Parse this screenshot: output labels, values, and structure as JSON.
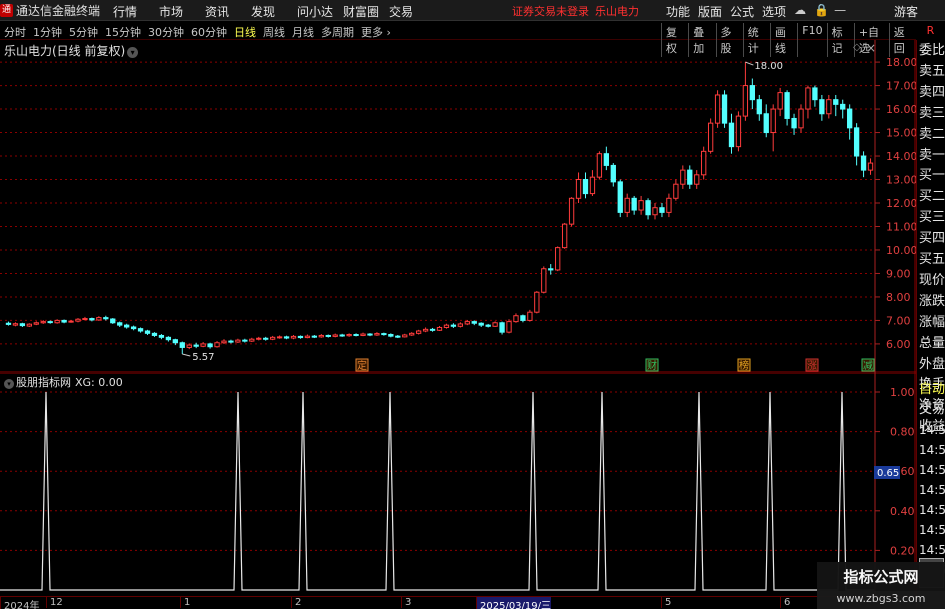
{
  "app": {
    "title": "通达信金融终端",
    "logo_text": "通"
  },
  "menu": [
    "行情",
    "市场",
    "资讯",
    "发现",
    "问小达",
    "财富圈",
    "交易"
  ],
  "notice": {
    "login_msg": "证券交易未登录",
    "stock_name": "乐山电力"
  },
  "top_right": [
    "功能",
    "版面",
    "公式",
    "选项"
  ],
  "user": "游客",
  "period_tabs": [
    {
      "label": "分时",
      "active": false
    },
    {
      "label": "1分钟",
      "active": false
    },
    {
      "label": "5分钟",
      "active": false
    },
    {
      "label": "15分钟",
      "active": false
    },
    {
      "label": "30分钟",
      "active": false
    },
    {
      "label": "60分钟",
      "active": false
    },
    {
      "label": "日线",
      "active": true
    },
    {
      "label": "周线",
      "active": false
    },
    {
      "label": "月线",
      "active": false
    },
    {
      "label": "多周期",
      "active": false
    },
    {
      "label": "更多 ›",
      "active": false
    }
  ],
  "chart_tools": [
    "复权",
    "叠加",
    "多股",
    "统计",
    "画线",
    "F10",
    "标记",
    "+自选",
    "返回"
  ],
  "rpanel_top": "R",
  "stock_label": "乐山电力(日线 前复权)",
  "indicator_label": {
    "name": "股朋指标网",
    "value": "XG: 0.00"
  },
  "side_panel": [
    "委比",
    "卖五",
    "卖四",
    "卖三",
    "卖二",
    "卖一",
    "买一",
    "买二",
    "买三",
    "买四",
    "买五",
    "现价",
    "涨跌",
    "涨幅",
    "总量",
    "外盘",
    "换手",
    "净资",
    "收益"
  ],
  "side_panel_lower": [
    {
      "label": "自动",
      "highlight": true
    },
    {
      "label": "交易",
      "highlight": false
    },
    {
      "label": "14:56",
      "highlight": false
    },
    {
      "label": "14:56",
      "highlight": false
    },
    {
      "label": "14:56",
      "highlight": false
    },
    {
      "label": "14:56",
      "highlight": false
    },
    {
      "label": "14:56",
      "highlight": false
    },
    {
      "label": "14:56",
      "highlight": false
    },
    {
      "label": "14:56",
      "highlight": false
    },
    {
      "label": "14:56",
      "highlight": false
    }
  ],
  "price_axis": [
    "18.00",
    "17.00",
    "16.00",
    "15.00",
    "14.00",
    "13.00",
    "12.00",
    "11.00",
    "10.00",
    "9.00",
    "8.00",
    "7.00",
    "6.00"
  ],
  "ind_axis": [
    "1.00",
    "0.80",
    "0.60",
    "0.40",
    "0.20"
  ],
  "ind_current": "0.65",
  "annotations": {
    "high": "18.00",
    "low": "5.57"
  },
  "event_tags": [
    "定",
    "财",
    "榜",
    "涨",
    "减"
  ],
  "date_labels": [
    {
      "label": "2024年",
      "current": false
    },
    {
      "label": "12",
      "current": false
    },
    {
      "label": "1",
      "current": false
    },
    {
      "label": "2",
      "current": false
    },
    {
      "label": "3",
      "current": false
    },
    {
      "label": "2025/03/19/三",
      "current": true
    },
    {
      "label": "5",
      "current": false
    },
    {
      "label": "6",
      "current": false
    }
  ],
  "watermark": {
    "line1": "指标公式网",
    "line2": "www.zbgs3.com"
  },
  "chart_data": {
    "type": "candlestick",
    "title": "乐山电力(日线 前复权)",
    "ylim": [
      5.4,
      18.6
    ],
    "colors": {
      "up": "#ff3c3c",
      "down": "#54ffff",
      "grid": "#8b0000"
    },
    "candles": [
      [
        6.88,
        6.83,
        6.95,
        6.78
      ],
      [
        6.8,
        6.86,
        6.92,
        6.75
      ],
      [
        6.86,
        6.78,
        6.9,
        6.72
      ],
      [
        6.76,
        6.84,
        6.88,
        6.72
      ],
      [
        6.84,
        6.9,
        6.96,
        6.8
      ],
      [
        6.9,
        6.95,
        7.01,
        6.85
      ],
      [
        6.95,
        6.92,
        7.0,
        6.86
      ],
      [
        6.9,
        7.0,
        7.05,
        6.86
      ],
      [
        7.0,
        6.93,
        7.04,
        6.88
      ],
      [
        6.93,
        6.97,
        7.02,
        6.9
      ],
      [
        6.97,
        7.05,
        7.1,
        6.92
      ],
      [
        7.05,
        7.08,
        7.15,
        7.0
      ],
      [
        7.08,
        7.02,
        7.12,
        6.96
      ],
      [
        7.02,
        7.12,
        7.18,
        6.98
      ],
      [
        7.12,
        7.07,
        7.2,
        7.0
      ],
      [
        7.06,
        6.9,
        7.1,
        6.85
      ],
      [
        6.9,
        6.8,
        6.95,
        6.72
      ],
      [
        6.8,
        6.72,
        6.86,
        6.65
      ],
      [
        6.72,
        6.65,
        6.78,
        6.58
      ],
      [
        6.65,
        6.55,
        6.7,
        6.48
      ],
      [
        6.55,
        6.45,
        6.6,
        6.38
      ],
      [
        6.45,
        6.36,
        6.5,
        6.3
      ],
      [
        6.36,
        6.28,
        6.42,
        6.2
      ],
      [
        6.28,
        6.18,
        6.33,
        6.1
      ],
      [
        6.18,
        6.05,
        6.22,
        5.95
      ],
      [
        6.05,
        5.85,
        6.1,
        5.57
      ],
      [
        5.85,
        5.95,
        6.02,
        5.78
      ],
      [
        5.95,
        5.9,
        6.05,
        5.82
      ],
      [
        5.9,
        6.0,
        6.08,
        5.86
      ],
      [
        6.0,
        5.88,
        6.05,
        5.8
      ],
      [
        5.88,
        6.05,
        6.12,
        5.84
      ],
      [
        6.05,
        6.12,
        6.2,
        6.0
      ],
      [
        6.12,
        6.08,
        6.18,
        6.02
      ],
      [
        6.08,
        6.16,
        6.22,
        6.04
      ],
      [
        6.16,
        6.12,
        6.22,
        6.06
      ],
      [
        6.12,
        6.2,
        6.26,
        6.08
      ],
      [
        6.2,
        6.24,
        6.3,
        6.15
      ],
      [
        6.24,
        6.2,
        6.3,
        6.14
      ],
      [
        6.2,
        6.28,
        6.34,
        6.16
      ],
      [
        6.28,
        6.3,
        6.36,
        6.22
      ],
      [
        6.3,
        6.25,
        6.35,
        6.2
      ],
      [
        6.25,
        6.32,
        6.38,
        6.2
      ],
      [
        6.32,
        6.27,
        6.36,
        6.22
      ],
      [
        6.27,
        6.33,
        6.4,
        6.24
      ],
      [
        6.33,
        6.3,
        6.38,
        6.25
      ],
      [
        6.3,
        6.36,
        6.42,
        6.26
      ],
      [
        6.36,
        6.32,
        6.4,
        6.27
      ],
      [
        6.32,
        6.38,
        6.44,
        6.28
      ],
      [
        6.38,
        6.35,
        6.43,
        6.3
      ],
      [
        6.35,
        6.4,
        6.45,
        6.3
      ],
      [
        6.4,
        6.36,
        6.45,
        6.32
      ],
      [
        6.36,
        6.42,
        6.48,
        6.33
      ],
      [
        6.42,
        6.38,
        6.46,
        6.33
      ],
      [
        6.38,
        6.44,
        6.5,
        6.34
      ],
      [
        6.44,
        6.4,
        6.48,
        6.35
      ],
      [
        6.4,
        6.33,
        6.45,
        6.28
      ],
      [
        6.33,
        6.3,
        6.38,
        6.25
      ],
      [
        6.3,
        6.38,
        6.43,
        6.27
      ],
      [
        6.38,
        6.45,
        6.5,
        6.34
      ],
      [
        6.45,
        6.55,
        6.6,
        6.4
      ],
      [
        6.55,
        6.62,
        6.7,
        6.5
      ],
      [
        6.62,
        6.58,
        6.68,
        6.52
      ],
      [
        6.58,
        6.7,
        6.76,
        6.55
      ],
      [
        6.7,
        6.8,
        6.86,
        6.65
      ],
      [
        6.8,
        6.75,
        6.88,
        6.68
      ],
      [
        6.75,
        6.85,
        6.92,
        6.7
      ],
      [
        6.85,
        6.95,
        7.02,
        6.8
      ],
      [
        6.95,
        6.88,
        7.0,
        6.8
      ],
      [
        6.88,
        6.8,
        6.92,
        6.72
      ],
      [
        6.8,
        6.75,
        6.85,
        6.7
      ],
      [
        6.75,
        6.9,
        6.96,
        6.72
      ],
      [
        6.9,
        6.5,
        6.95,
        6.4
      ],
      [
        6.5,
        6.95,
        7.05,
        6.45
      ],
      [
        6.95,
        7.2,
        7.3,
        6.9
      ],
      [
        7.2,
        7.0,
        7.25,
        6.92
      ],
      [
        7.0,
        7.35,
        7.45,
        6.95
      ],
      [
        7.35,
        8.2,
        8.25,
        7.3
      ],
      [
        8.2,
        9.2,
        9.3,
        8.15
      ],
      [
        9.2,
        9.15,
        9.4,
        8.95
      ],
      [
        9.15,
        10.1,
        10.15,
        9.1
      ],
      [
        10.1,
        11.1,
        11.15,
        10.05
      ],
      [
        11.1,
        12.2,
        12.25,
        11.0
      ],
      [
        12.2,
        13.0,
        13.3,
        12.0
      ],
      [
        13.0,
        12.4,
        13.3,
        12.2
      ],
      [
        12.4,
        13.1,
        13.4,
        12.3
      ],
      [
        13.1,
        14.1,
        14.2,
        13.0
      ],
      [
        14.1,
        13.6,
        14.4,
        13.4
      ],
      [
        13.6,
        12.9,
        13.7,
        12.7
      ],
      [
        12.9,
        11.6,
        13.0,
        11.4
      ],
      [
        11.6,
        12.2,
        12.4,
        11.4
      ],
      [
        12.2,
        11.7,
        12.3,
        11.5
      ],
      [
        11.7,
        12.1,
        12.3,
        11.5
      ],
      [
        12.1,
        11.5,
        12.2,
        11.3
      ],
      [
        11.5,
        11.8,
        12.0,
        11.3
      ],
      [
        11.8,
        11.6,
        12.0,
        11.4
      ],
      [
        11.6,
        12.2,
        12.4,
        11.4
      ],
      [
        12.2,
        12.8,
        13.0,
        12.1
      ],
      [
        12.8,
        13.4,
        13.6,
        12.6
      ],
      [
        13.4,
        12.8,
        13.6,
        12.6
      ],
      [
        12.8,
        13.2,
        13.4,
        12.6
      ],
      [
        13.2,
        14.2,
        14.4,
        13.0
      ],
      [
        14.2,
        15.4,
        15.6,
        14.1
      ],
      [
        15.4,
        16.6,
        16.8,
        15.2
      ],
      [
        16.6,
        15.4,
        16.8,
        15.2
      ],
      [
        15.4,
        14.4,
        15.8,
        14.1
      ],
      [
        14.4,
        15.7,
        15.9,
        14.2
      ],
      [
        15.7,
        17.0,
        18.0,
        15.5
      ],
      [
        17.0,
        16.4,
        17.3,
        16.0
      ],
      [
        16.4,
        15.8,
        16.6,
        15.5
      ],
      [
        15.8,
        15.0,
        16.2,
        14.8
      ],
      [
        15.0,
        16.0,
        16.2,
        14.2
      ],
      [
        16.0,
        16.7,
        16.9,
        15.7
      ],
      [
        16.7,
        15.6,
        16.8,
        15.3
      ],
      [
        15.6,
        15.2,
        15.8,
        14.9
      ],
      [
        15.2,
        16.0,
        16.2,
        15.0
      ],
      [
        16.0,
        16.9,
        17.0,
        15.6
      ],
      [
        16.9,
        16.4,
        17.0,
        16.1
      ],
      [
        16.4,
        15.8,
        16.6,
        15.5
      ],
      [
        15.8,
        16.4,
        16.6,
        15.6
      ],
      [
        16.4,
        16.2,
        16.6,
        15.7
      ],
      [
        16.2,
        16.0,
        16.4,
        15.6
      ],
      [
        16.0,
        15.2,
        16.2,
        14.7
      ],
      [
        15.2,
        14.0,
        15.4,
        13.6
      ],
      [
        14.0,
        13.4,
        14.2,
        13.1
      ],
      [
        13.4,
        13.7,
        13.9,
        13.2
      ]
    ],
    "high_label": 18.0,
    "low_label": 5.57,
    "indicator": {
      "name": "XG",
      "ylim": [
        0,
        1
      ],
      "signal_indices": [
        10,
        44,
        56,
        72,
        98,
        110,
        129,
        142,
        158
      ]
    }
  }
}
